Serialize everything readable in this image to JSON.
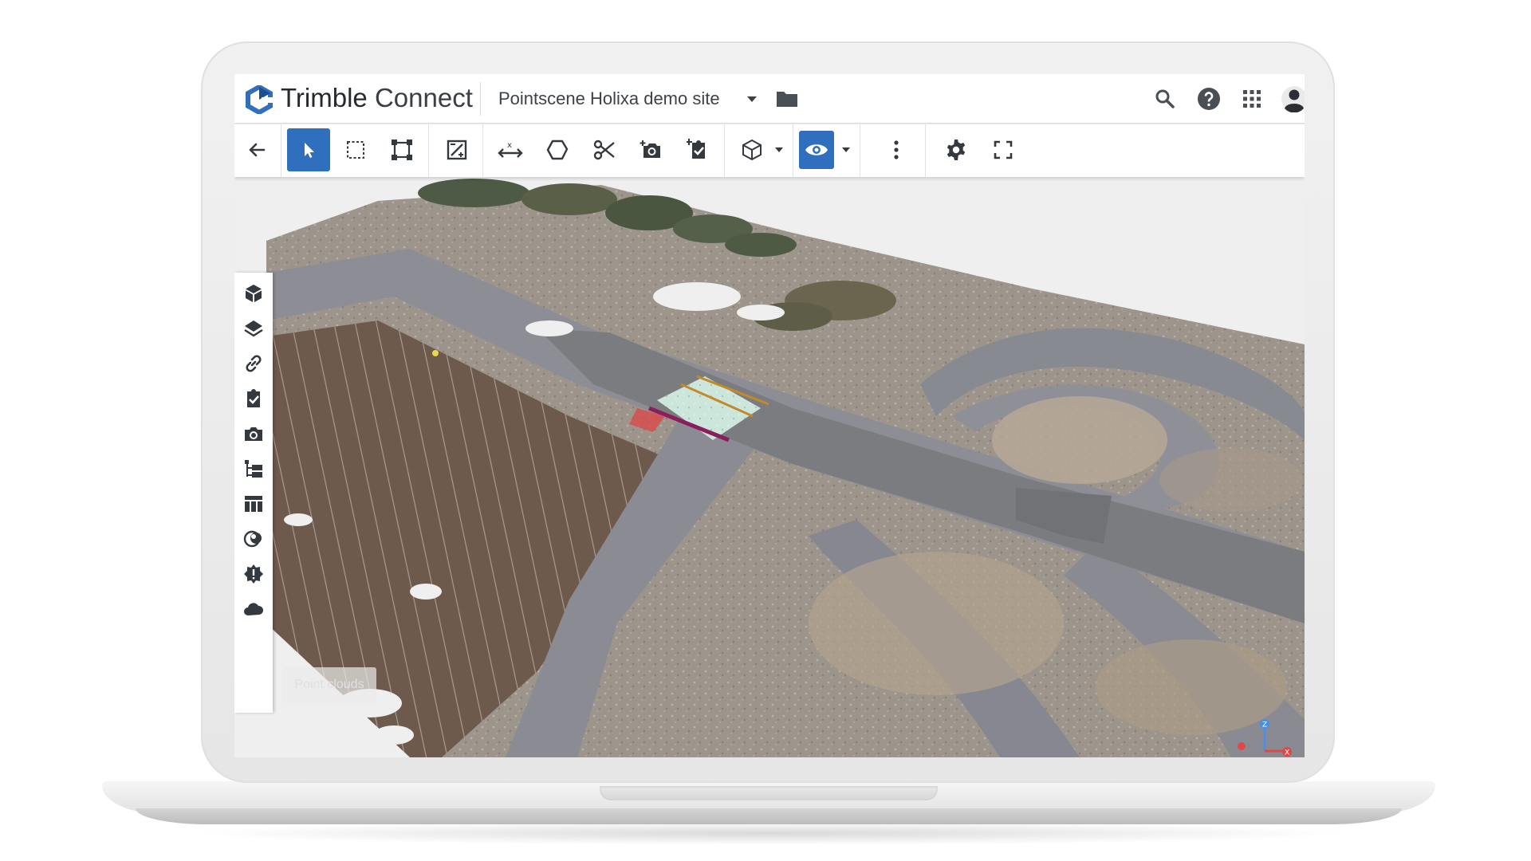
{
  "app": {
    "brand_primary": "Trimble",
    "brand_secondary": "Connect",
    "accent_color": "#2f6fbd",
    "logo_icon": "trimble-connect-logo"
  },
  "header": {
    "project_name": "Pointscene Holixa demo site",
    "project_dropdown_icon": "caret-down-icon",
    "folder_icon": "folder-icon",
    "right_icons": [
      "search-icon",
      "help-icon",
      "apps-grid-icon",
      "user-avatar-icon"
    ]
  },
  "toolbar": {
    "tools": [
      {
        "icon": "back-arrow-icon",
        "active": false
      },
      {
        "icon": "select-pointer-icon",
        "active": true
      },
      {
        "icon": "box-select-icon",
        "active": false
      },
      {
        "icon": "bounding-box-icon",
        "active": false
      },
      {
        "icon": "markup-icon",
        "active": false
      },
      {
        "icon": "measure-icon",
        "active": false
      },
      {
        "icon": "lasso-icon",
        "active": false
      },
      {
        "icon": "clip-scissors-icon",
        "active": false
      },
      {
        "icon": "add-view-icon",
        "active": false
      },
      {
        "icon": "add-todo-icon",
        "active": false
      },
      {
        "icon": "3d-cube-icon",
        "active": false,
        "has_dropdown": true
      },
      {
        "icon": "visibility-eye-icon",
        "active": true,
        "has_dropdown": true
      },
      {
        "icon": "more-vertical-icon",
        "active": false
      },
      {
        "icon": "settings-gear-icon",
        "active": false
      },
      {
        "icon": "fullscreen-icon",
        "active": false
      }
    ]
  },
  "sidebar": {
    "items": [
      {
        "icon": "models-cube-icon"
      },
      {
        "icon": "layers-icon"
      },
      {
        "icon": "links-icon"
      },
      {
        "icon": "todos-check-icon"
      },
      {
        "icon": "views-camera-icon"
      },
      {
        "icon": "hierarchy-tree-icon"
      },
      {
        "icon": "table-icon"
      },
      {
        "icon": "clash-spheres-icon"
      },
      {
        "icon": "issues-alert-icon"
      },
      {
        "icon": "point-clouds-icon"
      }
    ],
    "tooltip": "Point clouds"
  },
  "viewport": {
    "content": "3d-point-cloud-site-scan",
    "axis_labels": [
      "Z",
      "X"
    ]
  }
}
